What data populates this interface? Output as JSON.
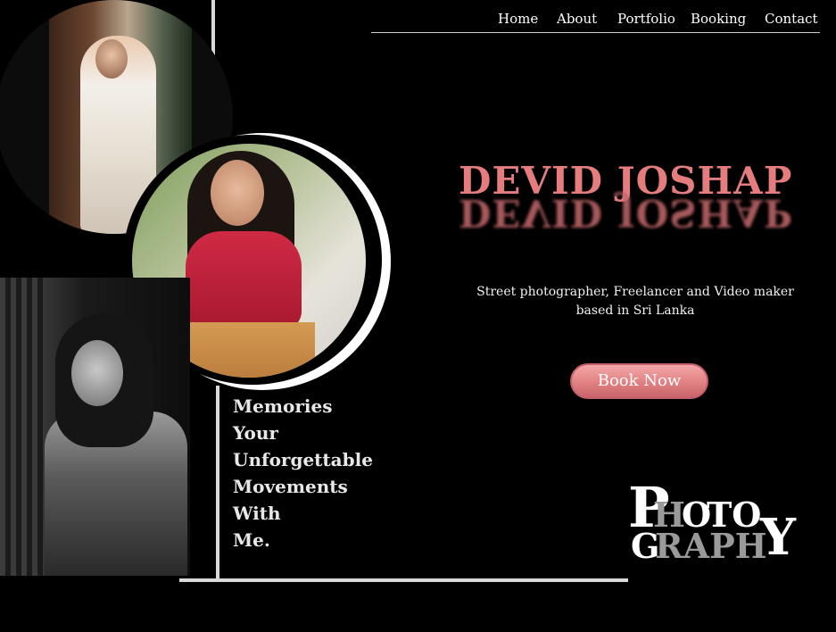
{
  "nav": {
    "items": [
      {
        "label": "Home"
      },
      {
        "label": "About"
      },
      {
        "label": "Portfolio"
      },
      {
        "label": "Booking"
      },
      {
        "label": "Contact"
      }
    ]
  },
  "hero": {
    "name": "DEVID JOSHAP",
    "bio": "Street photographer, Freelancer and Video maker based in Sri Lanka",
    "cta_label": "Book Now",
    "tagline": [
      "Memories",
      "Your",
      "Unforgettable",
      "Movements",
      "With",
      "Me."
    ]
  },
  "logo": {
    "p": "P",
    "h": "H",
    "oto": "O",
    "to": "TO",
    "g": "G",
    "raph": "RAPH",
    "y": "Y"
  },
  "colors": {
    "background": "#000000",
    "accent": "#e57d7f",
    "button": "#e48486",
    "lines": "#d9d9d9"
  }
}
